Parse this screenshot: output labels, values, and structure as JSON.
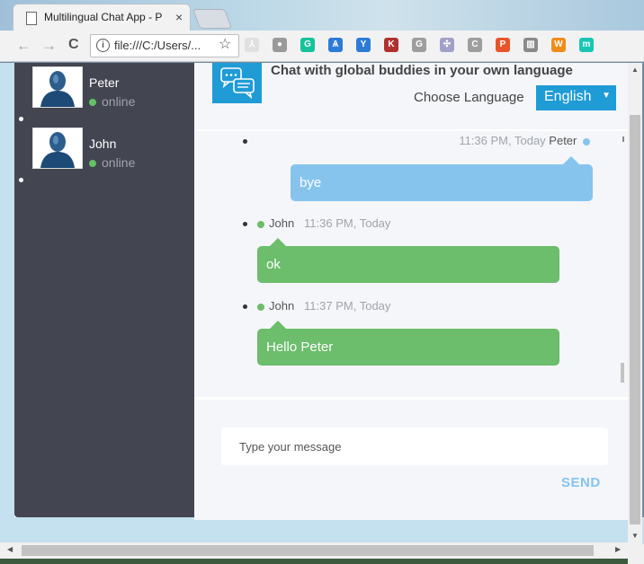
{
  "browser": {
    "tab_title": "Multilingual Chat App - P",
    "tab_close": "×",
    "address_url": "file:///C:/Users/...",
    "info_glyph": "i",
    "back": "←",
    "forward": "→",
    "reload": "C",
    "star": "☆",
    "extensions": [
      {
        "icon": "pdf-icon",
        "color": "#e0e0e0",
        "glyph": "⅄"
      },
      {
        "icon": "circle-icon",
        "color": "#9a9a9a",
        "glyph": "●"
      },
      {
        "icon": "grammarly-icon",
        "color": "#15c39a",
        "glyph": "G"
      },
      {
        "icon": "flame-icon",
        "color": "#2d7bd6",
        "glyph": "Ѧ"
      },
      {
        "icon": "yoast-icon",
        "color": "#2d7bd6",
        "glyph": "Y"
      },
      {
        "icon": "k-icon",
        "color": "#b03030",
        "glyph": "K"
      },
      {
        "icon": "g-icon",
        "color": "#9e9e9e",
        "glyph": "G"
      },
      {
        "icon": "react-icon",
        "color": "#a0a0c8",
        "glyph": "✣"
      },
      {
        "icon": "c-icon",
        "color": "#9e9e9e",
        "glyph": "C"
      },
      {
        "icon": "p-icon",
        "color": "#e8542a",
        "glyph": "P"
      },
      {
        "icon": "columns-icon",
        "color": "#8a8a8a",
        "glyph": "▥"
      },
      {
        "icon": "w-icon",
        "color": "#f08c1a",
        "glyph": "W"
      },
      {
        "icon": "m-icon",
        "color": "#19c6b4",
        "glyph": "m"
      }
    ]
  },
  "sidebar": {
    "users": [
      {
        "name": "Peter",
        "status": "online"
      },
      {
        "name": "John",
        "status": "online"
      }
    ]
  },
  "header": {
    "tagline": "Chat with global buddies in your own language",
    "language_label": "Choose Language",
    "language_value": "English",
    "language_arrow": "▼"
  },
  "messages": [
    {
      "meta_time": "11:36 PM, Today",
      "sender": "Peter",
      "text": "bye"
    },
    {
      "sender": "John",
      "meta_time": "11:36 PM, Today",
      "text": "ok"
    },
    {
      "sender": "John",
      "meta_time": "11:37 PM, Today",
      "text": "Hello Peter"
    }
  ],
  "composer": {
    "placeholder": "Type your message",
    "send_label": "SEND"
  },
  "colors": {
    "sidebar": "#434651",
    "accent": "#1f9bd6",
    "online": "#64c165",
    "bubble_self": "#86c4ee",
    "bubble_other": "#6cbd6c"
  }
}
